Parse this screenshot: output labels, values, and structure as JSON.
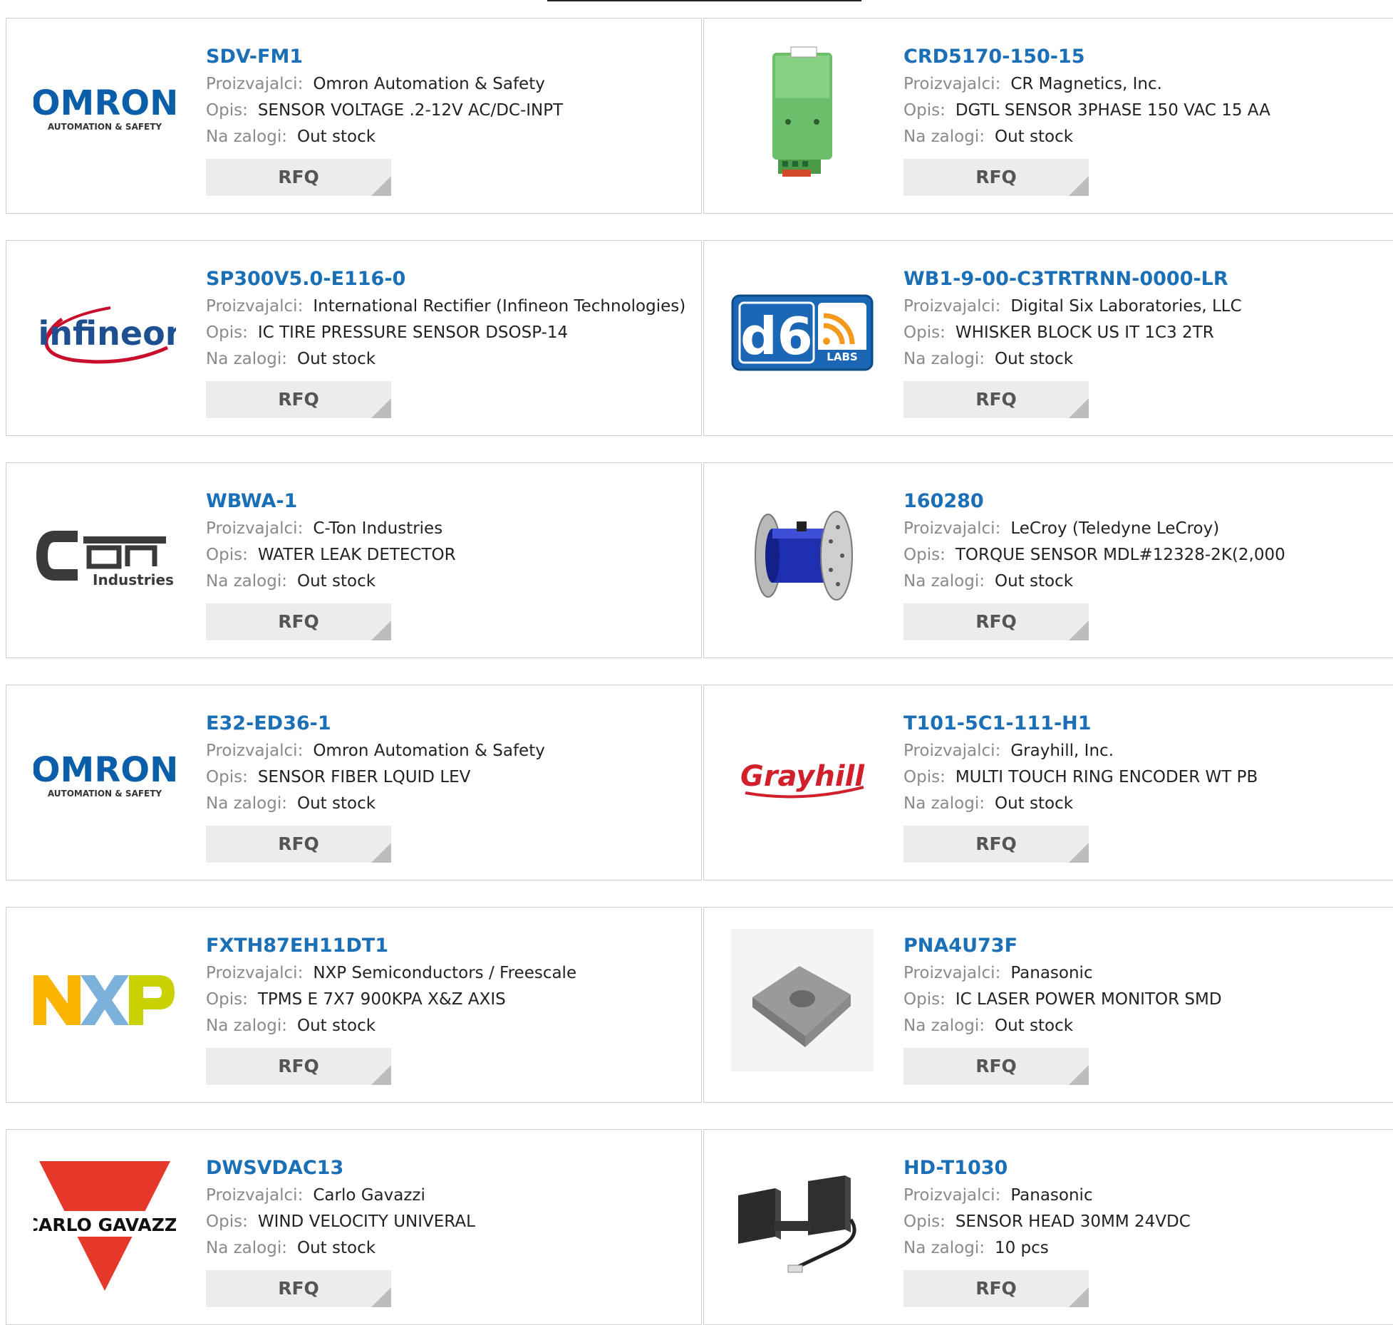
{
  "labels": {
    "manufacturer": "Proizvajalci:",
    "description": "Opis:",
    "stock": "Na zalogi:",
    "rfq": "RFQ"
  },
  "logo_text": {
    "omron_main": "OMRON",
    "omron_sub": "AUTOMATION & SAFETY",
    "infineon": "infineon",
    "cton_ct": "C",
    "cton_industries": "Industries",
    "d6_main": "d6",
    "d6_sub": "LABS",
    "grayhill": "Grayhill",
    "carlo": "CARLO GAVAZZI"
  },
  "products": [
    {
      "part": "SDV-FM1",
      "manufacturer": "Omron Automation & Safety",
      "description": "SENSOR VOLTAGE .2-12V AC/DC-INPT",
      "stock": "Out stock",
      "image": "omron-logo"
    },
    {
      "part": "CRD5170-150-15",
      "manufacturer": "CR Magnetics, Inc.",
      "description": "DGTL SENSOR 3PHASE 150 VAC 15 AA",
      "stock": "Out stock",
      "image": "green-module-photo"
    },
    {
      "part": "SP300V5.0-E116-0",
      "manufacturer": "International Rectifier (Infineon Technologies)",
      "description": "IC TIRE PRESSURE SENSOR DSOSP-14",
      "stock": "Out stock",
      "image": "infineon-logo"
    },
    {
      "part": "WB1-9-00-C3TRTRNN-0000-LR",
      "manufacturer": "Digital Six Laboratories, LLC",
      "description": "WHISKER BLOCK US IT 1C3 2TR",
      "stock": "Out stock",
      "image": "d6-labs-logo"
    },
    {
      "part": "WBWA-1",
      "manufacturer": "C-Ton Industries",
      "description": "WATER LEAK DETECTOR",
      "stock": "Out stock",
      "image": "cton-logo"
    },
    {
      "part": "160280",
      "manufacturer": "LeCroy (Teledyne LeCroy)",
      "description": "TORQUE SENSOR MDL#12328-2K(2,000",
      "stock": "Out stock",
      "image": "torque-sensor-photo"
    },
    {
      "part": "E32-ED36-1",
      "manufacturer": "Omron Automation & Safety",
      "description": "SENSOR FIBER LQUID LEV",
      "stock": "Out stock",
      "image": "omron-logo"
    },
    {
      "part": "T101-5C1-111-H1",
      "manufacturer": "Grayhill, Inc.",
      "description": "MULTI TOUCH RING ENCODER WT PB",
      "stock": "Out stock",
      "image": "grayhill-logo"
    },
    {
      "part": "FXTH87EH11DT1",
      "manufacturer": "NXP Semiconductors / Freescale",
      "description": "TPMS E 7X7 900KPA X&Z AXIS",
      "stock": "Out stock",
      "image": "nxp-logo"
    },
    {
      "part": "PNA4U73F",
      "manufacturer": "Panasonic",
      "description": "IC LASER POWER MONITOR SMD",
      "stock": "Out stock",
      "image": "laser-chip-photo"
    },
    {
      "part": "DWSVDAC13",
      "manufacturer": "Carlo Gavazzi",
      "description": "WIND VELOCITY UNIVERAL",
      "stock": "Out stock",
      "image": "carlo-gavazzi-logo"
    },
    {
      "part": "HD-T1030",
      "manufacturer": "Panasonic",
      "description": "SENSOR HEAD 30MM 24VDC",
      "stock": "10 pcs",
      "image": "sensor-head-photo"
    }
  ]
}
